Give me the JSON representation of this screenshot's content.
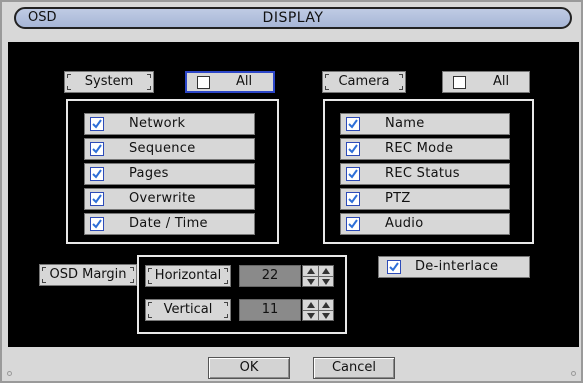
{
  "window": {
    "left_title": "OSD",
    "center_title": "DISPLAY"
  },
  "system": {
    "button_label": "System",
    "all_label": "All",
    "all_checked": false,
    "items": [
      {
        "label": "Network",
        "checked": true
      },
      {
        "label": "Sequence",
        "checked": true
      },
      {
        "label": "Pages",
        "checked": true
      },
      {
        "label": "Overwrite",
        "checked": true
      },
      {
        "label": "Date / Time",
        "checked": true
      }
    ]
  },
  "camera": {
    "button_label": "Camera",
    "all_label": "All",
    "all_checked": false,
    "items": [
      {
        "label": "Name",
        "checked": true
      },
      {
        "label": "REC Mode",
        "checked": true
      },
      {
        "label": "REC Status",
        "checked": true
      },
      {
        "label": "PTZ",
        "checked": true
      },
      {
        "label": "Audio",
        "checked": true
      }
    ]
  },
  "osd_margin": {
    "label": "OSD Margin",
    "horizontal_label": "Horizontal",
    "horizontal_value": "22",
    "vertical_label": "Vertical",
    "vertical_value": "11"
  },
  "deinterlace": {
    "label": "De-interlace",
    "checked": true
  },
  "footer": {
    "ok_label": "OK",
    "cancel_label": "Cancel"
  },
  "colors": {
    "checkbox_border": "#2d4bb8",
    "check_mark": "#2e6fd8",
    "all_focus_border": "#2c46c8",
    "title_bar": "#a7b6d6"
  }
}
